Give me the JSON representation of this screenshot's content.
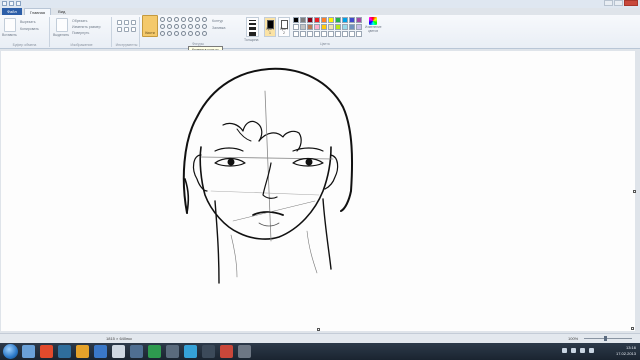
{
  "window": {
    "file_tab": "Файл",
    "tabs": [
      "Главная",
      "Вид"
    ]
  },
  "ribbon": {
    "clipboard": {
      "paste_label": "Вставить",
      "cut_label": "Вырезать",
      "copy_label": "Копировать",
      "group_label": "Буфер обмена"
    },
    "image": {
      "select_label": "Выделить",
      "crop_label": "Обрезать",
      "resize_label": "Изменить размер",
      "rotate_label": "Повернуть",
      "group_label": "Изображение"
    },
    "tools": {
      "group_label": "Инструменты"
    },
    "brushes": {
      "label": "Кисти"
    },
    "shapes": {
      "outline_label": "Контур",
      "fill_label": "Заливка",
      "group_label": "Фигуры"
    },
    "size": {
      "label": "Толщина"
    },
    "colors": {
      "color1_label": "Цвет 1",
      "color2_label": "Цвет 2",
      "edit_label": "Изменение цветов",
      "group_label": "Цвета"
    },
    "palette": [
      "#000000",
      "#7f7f7f",
      "#880015",
      "#ed1c24",
      "#ff7f27",
      "#fff200",
      "#22b14c",
      "#00a2e8",
      "#3f48cc",
      "#a349a4",
      "#ffffff",
      "#c3c3c3",
      "#b97a57",
      "#ffaec9",
      "#ffc90e",
      "#efe4b0",
      "#b5e61d",
      "#99d9ea",
      "#7092be",
      "#c8bfe7",
      "#ffffff",
      "#ffffff",
      "#ffffff",
      "#ffffff",
      "#ffffff",
      "#ffffff",
      "#ffffff",
      "#ffffff",
      "#ffffff",
      "#ffffff"
    ],
    "color1": "#000000",
    "color2": "#ffffff"
  },
  "tooltip": "Кривая в кольцо",
  "status": {
    "cursor_position": "1815 × 640пкс",
    "zoom": "100%"
  },
  "taskbar": {
    "time": "13:16",
    "date": "17.02.2013"
  }
}
